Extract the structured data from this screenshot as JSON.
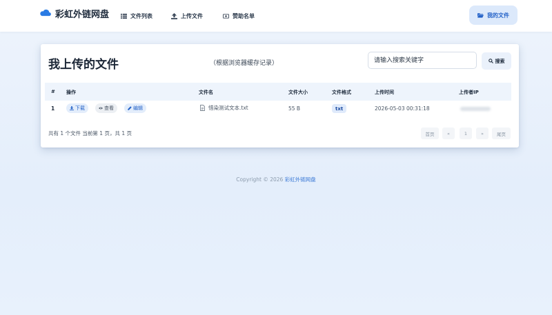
{
  "navbar": {
    "brand": "彩虹外链网盘",
    "items": [
      {
        "label": "文件列表",
        "icon": "list-icon"
      },
      {
        "label": "上传文件",
        "icon": "upload-icon"
      },
      {
        "label": "赞助名单",
        "icon": "money-icon"
      }
    ],
    "my_files": "我的文件"
  },
  "card": {
    "title": "我上传的文件",
    "subtitle": "（根据浏览器缓存记录）",
    "search_placeholder": "请输入搜索关键字",
    "search_label": "搜索"
  },
  "table": {
    "columns": [
      "#",
      "操作",
      "文件名",
      "文件大小",
      "文件格式",
      "上传时间",
      "上传者IP"
    ],
    "rows": [
      {
        "num": "1",
        "actions": {
          "download": "下载",
          "view": "查看",
          "edit": "编辑"
        },
        "filename": "惜染测试文本.txt",
        "size": "55 B",
        "format": "txt",
        "time": "2026-05-03 00:31:18"
      }
    ]
  },
  "summary": "共有 1 个文件  当前第 1 页，共 1 页",
  "pagination": {
    "first": "首页",
    "prev": "«",
    "current": "1",
    "next": "»",
    "last": "尾页"
  },
  "footer": {
    "prefix": "Copyright © 2026 ",
    "brand": "彩虹外链网盘"
  },
  "colors": {
    "accent": "#2563c8",
    "badge_bg": "#dfeafb"
  }
}
